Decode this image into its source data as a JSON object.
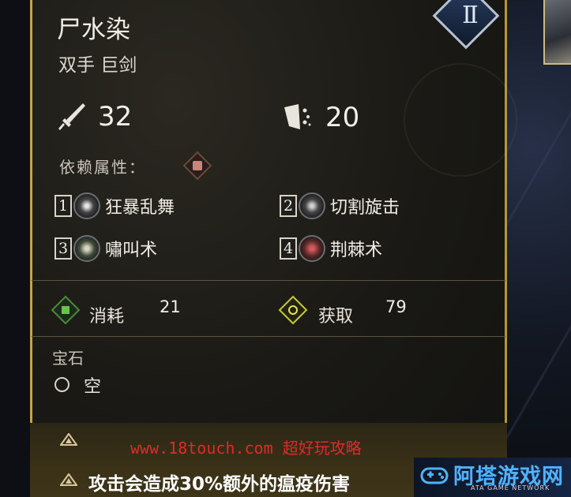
{
  "weapon": {
    "name": "尸水染",
    "type": "双手 巨剑",
    "damage": "32",
    "block": "20",
    "badge_level": "II"
  },
  "requirement": {
    "label": "依赖属性："
  },
  "skills": [
    {
      "slot": "1",
      "name": "狂暴乱舞"
    },
    {
      "slot": "2",
      "name": "切割旋击"
    },
    {
      "slot": "3",
      "name": "嘯叫术"
    },
    {
      "slot": "4",
      "name": "荆棘术"
    }
  ],
  "economy": {
    "consume_label": "消耗",
    "consume_value": "21",
    "gain_label": "获取",
    "gain_value": "79"
  },
  "gem": {
    "title": "宝石",
    "value": "空"
  },
  "perk": {
    "text": "攻击会造成30%额外的瘟疫伤害"
  },
  "overlay": {
    "watermark": "www.18touch.com 超好玩攻略",
    "brand_main": "阿塔游戏网",
    "brand_sub": "ATA GAME NETWORK"
  },
  "colors": {
    "panel_border": "#c9a53a",
    "watermark_red": "#e02a2a",
    "brand_blue": "#4fb3ff",
    "consume_green": "#4a8a3a",
    "gain_yellow": "#c8c83a"
  }
}
